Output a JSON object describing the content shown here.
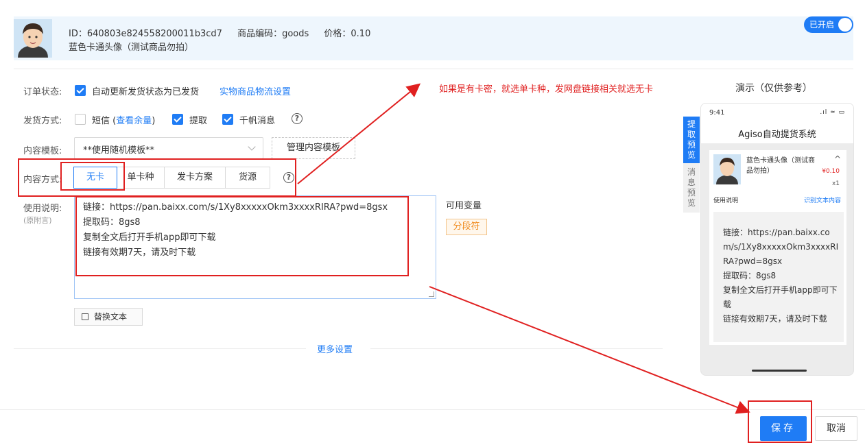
{
  "product": {
    "id_text": "ID：640803e824558200011b3cd7",
    "code_text": "商品编码：goods",
    "price_text": "价格：0.10",
    "name": "蓝色卡通头像（测试商品勿拍）",
    "toggle_label": "已开启"
  },
  "form": {
    "order_status_label": "订单状态:",
    "order_status_check_text": "自动更新发货状态为已发货",
    "logistics_link": "实物商品物流设置",
    "delivery_label": "发货方式:",
    "sms_label": "短信",
    "sms_paren_open": "(",
    "sms_link": "查看余量",
    "sms_paren_close": ")",
    "pickup_label": "提取",
    "qianniu_label": "千帆消息",
    "template_label": "内容模板:",
    "template_value": "**使用随机模板**",
    "manage_template_button": "管理内容模板",
    "content_mode_label": "内容方式:",
    "content_modes": [
      "无卡",
      "单卡种",
      "发卡方案",
      "货源"
    ],
    "usage_label": "使用说明:",
    "usage_sub_label": "(原附言)",
    "usage_lines": [
      "链接：https://pan.baixx.com/s/1Xy8xxxxxOkm3xxxxRIRA?pwd=8gsx",
      "提取码：8gs8",
      "复制全文后打开手机app即可下载",
      "链接有效期7天，请及时下载"
    ],
    "replace_text_button": "替换文本",
    "variables_label": "可用变量",
    "variable_tag": "分段符",
    "more_settings": "更多设置"
  },
  "annotation": {
    "text": "如果是有卡密，就选单卡种，发网盘链接相关就选无卡"
  },
  "preview": {
    "title": "演示（仅供参考）",
    "tab_pickup": "提取预览",
    "tab_message": "消息预览",
    "clock": "9:41",
    "app_title": "Agiso自动提货系统",
    "product_name": "蓝色卡通头像（测试商品勿拍）",
    "price": "¥0.10",
    "qty": "x1",
    "usage_label": "使用说明",
    "recognize_link": "识别文本内容",
    "body_lines": [
      "链接：https://pan.baixx.com/s/1Xy8xxxxxOkm3xxxxRIRA?pwd=8gsx",
      "提取码：8gs8",
      "复制全文后打开手机app即可下载",
      "链接有效期7天，请及时下载"
    ]
  },
  "footer": {
    "save_button": "保存",
    "cancel_button": "取消"
  },
  "colors": {
    "accent": "#1f7cf5",
    "annotation_red": "#e02020",
    "header_bg": "#eef6fd"
  }
}
